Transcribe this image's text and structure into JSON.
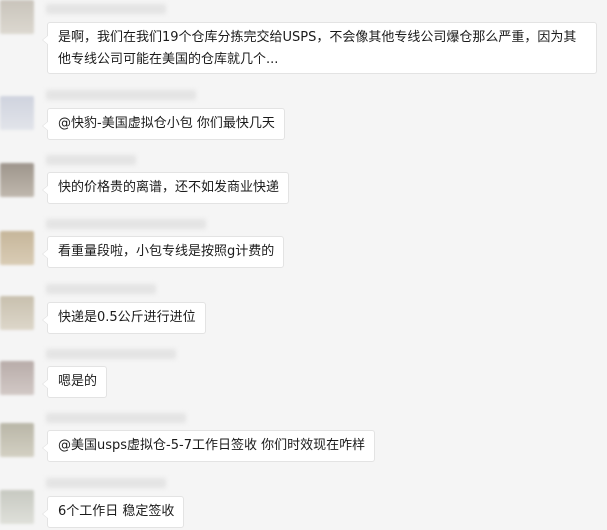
{
  "messages": [
    {
      "text": "是啊，我们在我们19个仓库分拣完交给USPS，不会像其他专线公司爆仓那么严重，因为其他专线公司可能在美国的仓库就几个..."
    },
    {
      "text": "@快豹-美国虚拟仓小包 你们最快几天"
    },
    {
      "text": "快的价格贵的离谱，还不如发商业快递"
    },
    {
      "text": "看重量段啦，小包专线是按照g计费的"
    },
    {
      "text": "快递是0.5公斤进行进位"
    },
    {
      "text": "嗯是的"
    },
    {
      "text": "@美国usps虚拟仓-5-7工作日签收 你们时效现在咋样"
    },
    {
      "text": "6个工作日 稳定签收"
    }
  ],
  "colors": {
    "background": "#f5f5f5",
    "bubble": "#ffffff",
    "bubble_border": "#e3e3e3",
    "text": "#1a1a1a"
  }
}
